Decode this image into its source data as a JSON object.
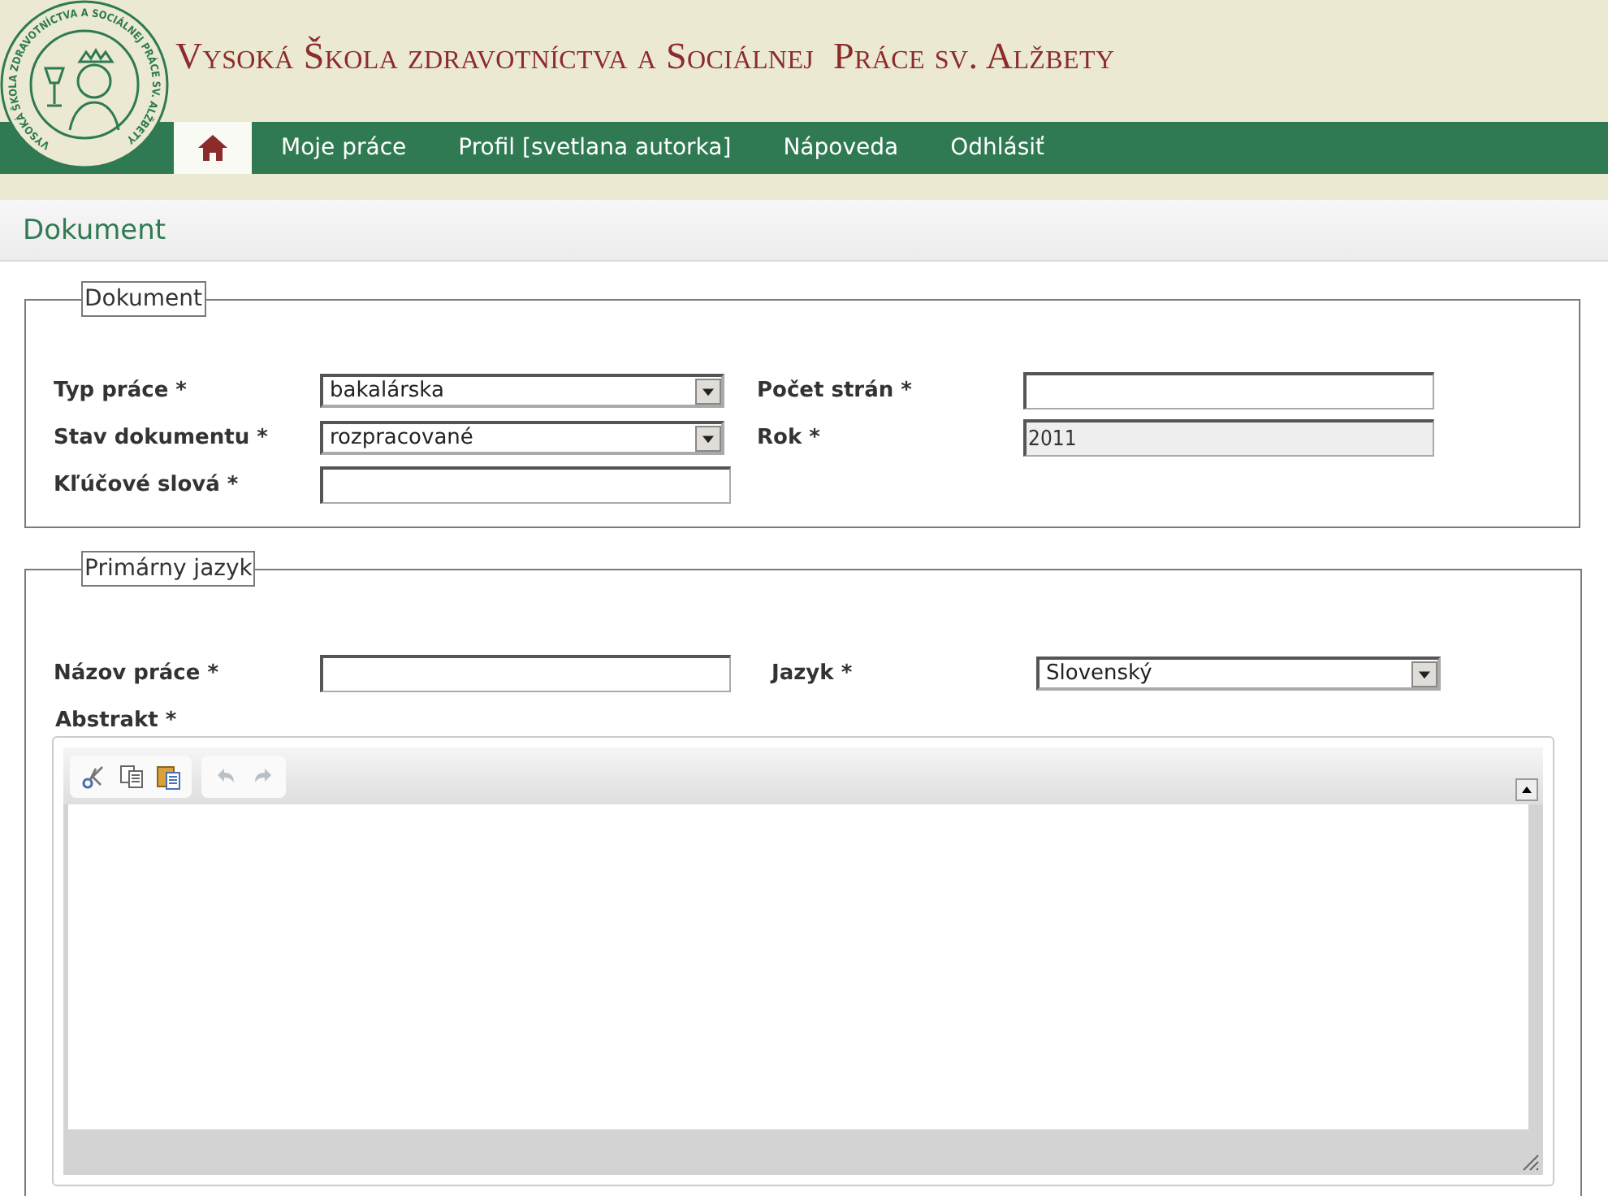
{
  "header": {
    "seal_text": "VYSOKÁ ŠKOLA ZDRAVOTNÍCTVA A SOCIÁLNEJ PRÁCE SV. ALŽBETY",
    "title": "Vysoká Škola zdravotníctva a Sociálnej  Práce sv. Alžbety"
  },
  "nav": [
    {
      "kind": "home",
      "selected": true
    },
    {
      "kind": "link",
      "label": "Moje práce",
      "selected": false
    },
    {
      "kind": "link",
      "label": "Profil [svetlana autorka]",
      "selected": false
    },
    {
      "kind": "link",
      "label": "Nápoveda",
      "selected": false
    },
    {
      "kind": "link",
      "label": "Odhlásiť",
      "selected": false
    }
  ],
  "page_title": "Dokument",
  "sections": [
    {
      "legend": "Dokument",
      "rows": [
        [
          {
            "label": "Typ práce *",
            "kind": "select",
            "value": "bakalárska"
          },
          {
            "label": "Počet strán *",
            "kind": "text"
          }
        ],
        [
          {
            "label": "Stav dokumentu *",
            "kind": "select",
            "value": "rozpracované"
          },
          {
            "label": "Rok *",
            "kind": "text",
            "value": "2011",
            "disabled": true
          }
        ],
        [
          {
            "label": "Kľúčové slová *",
            "kind": "text"
          }
        ]
      ]
    },
    {
      "legend": "Primárny jazyk",
      "rows": [
        [
          {
            "label": "Názov práce *",
            "kind": "text"
          },
          {
            "label": "Jazyk *",
            "kind": "select",
            "value": "Slovenský"
          }
        ]
      ],
      "editor": {
        "label": "Abstrakt *",
        "toolbar": [
          [
            {
              "kind": "cut",
              "disabled": false
            },
            {
              "kind": "copy",
              "disabled": false
            },
            {
              "kind": "paste",
              "disabled": false
            }
          ],
          [
            {
              "kind": "undo",
              "disabled": true
            },
            {
              "kind": "redo",
              "disabled": true
            }
          ]
        ]
      }
    }
  ]
}
